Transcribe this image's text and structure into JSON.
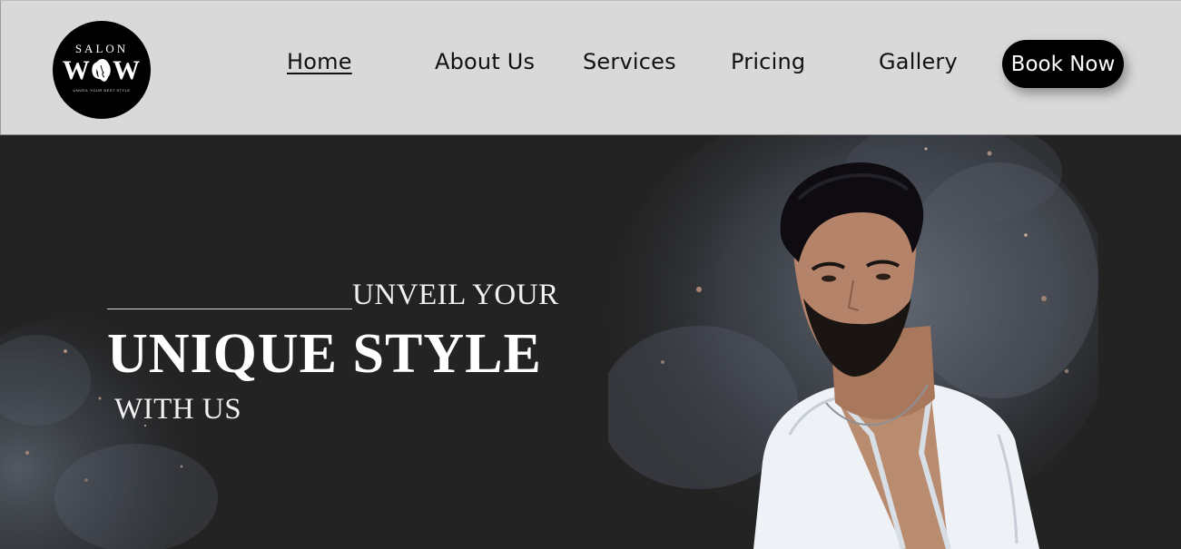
{
  "brand": {
    "logo_top": "SALON",
    "logo_main": "WOW",
    "logo_tagline": "UNVEIL YOUR BEST STYLE"
  },
  "nav": {
    "items": [
      {
        "label": "Home",
        "active": true
      },
      {
        "label": "About Us",
        "active": false
      },
      {
        "label": "Services",
        "active": false
      },
      {
        "label": "Pricing",
        "active": false
      },
      {
        "label": "Gallery",
        "active": false
      }
    ],
    "cta_label": "Book Now"
  },
  "hero": {
    "line1": "UNVEIL YOUR",
    "line2": "UNIQUE STYLE",
    "line3": "WITH US",
    "image": "man-portrait"
  },
  "colors": {
    "header_bg": "#d9d9d9",
    "hero_bg": "#232323",
    "cta_bg": "#000000",
    "cta_text": "#ffffff",
    "hero_text": "#ffffff"
  },
  "icons": {
    "logo": "salon-wow-logo"
  }
}
